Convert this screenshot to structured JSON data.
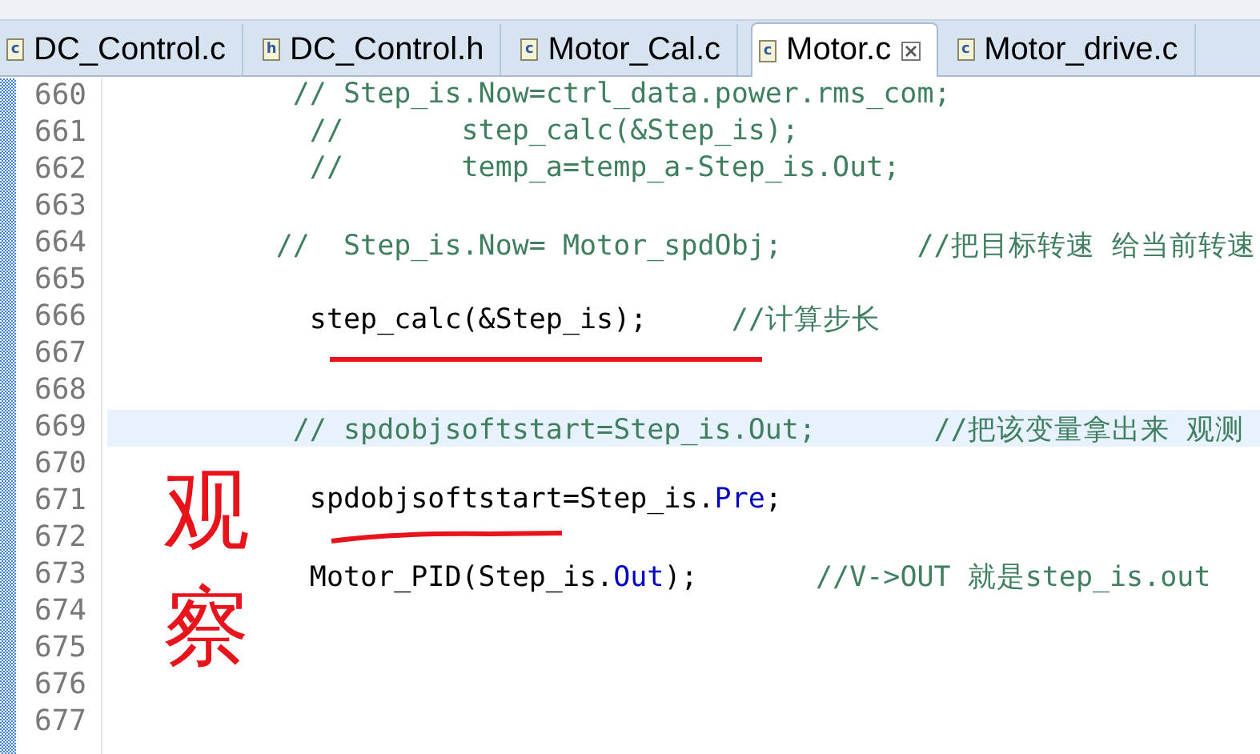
{
  "tabs": [
    {
      "label": "DC_Control.c",
      "icon_letter": "c",
      "selected": false
    },
    {
      "label": "DC_Control.h",
      "icon_letter": "h",
      "selected": false
    },
    {
      "label": "Motor_Cal.c",
      "icon_letter": "c",
      "selected": false
    },
    {
      "label": "Motor.c",
      "icon_letter": "c",
      "selected": true
    },
    {
      "label": "Motor_drive.c",
      "icon_letter": "c",
      "selected": false
    }
  ],
  "editor": {
    "lines": [
      {
        "number": "660",
        "highlighted": false,
        "segments": [
          {
            "kind": "comment",
            "text": "           // Step_is.Now=ctrl_data.power.rms_com;"
          }
        ]
      },
      {
        "number": "661",
        "highlighted": false,
        "segments": [
          {
            "kind": "comment",
            "text": "            //       step_calc(&Step_is);"
          }
        ]
      },
      {
        "number": "662",
        "highlighted": false,
        "segments": [
          {
            "kind": "comment",
            "text": "            //       temp_a=temp_a-Step_is.Out;"
          }
        ]
      },
      {
        "number": "663",
        "highlighted": false
      },
      {
        "number": "664",
        "highlighted": false,
        "segments": [
          {
            "kind": "comment",
            "text": "          //  Step_is.Now= Motor_spdObj;        //把目标转速 给当前转速"
          }
        ]
      },
      {
        "number": "665",
        "highlighted": false
      },
      {
        "number": "666",
        "highlighted": false,
        "segments": [
          {
            "kind": "code",
            "text": "            step_calc(&Step_is);"
          },
          {
            "kind": "comment",
            "text": "     //计算步长"
          }
        ]
      },
      {
        "number": "667",
        "highlighted": false
      },
      {
        "number": "668",
        "highlighted": false
      },
      {
        "number": "669",
        "highlighted": true,
        "segments": [
          {
            "kind": "comment",
            "text": "           // spdobjsoftstart=Step_is.Out;       //把该变量拿出来 观测"
          }
        ]
      },
      {
        "number": "670",
        "highlighted": false
      },
      {
        "number": "671",
        "highlighted": false,
        "segments": [
          {
            "kind": "code",
            "text": "            spdobjsoftstart=Step_is."
          },
          {
            "kind": "field",
            "text": "Pre"
          },
          {
            "kind": "code",
            "text": ";"
          }
        ]
      },
      {
        "number": "672",
        "highlighted": false
      },
      {
        "number": "673",
        "highlighted": false,
        "segments": [
          {
            "kind": "code",
            "text": "            Motor_PID(Step_is."
          },
          {
            "kind": "field",
            "text": "Out"
          },
          {
            "kind": "code",
            "text": ");"
          },
          {
            "kind": "comment",
            "text": "       //V->OUT 就是step_is.out"
          }
        ]
      },
      {
        "number": "674",
        "highlighted": false
      },
      {
        "number": "675",
        "highlighted": false
      },
      {
        "number": "676",
        "highlighted": false
      },
      {
        "number": "677",
        "highlighted": false
      }
    ]
  },
  "annotation": {
    "text": "观察"
  }
}
